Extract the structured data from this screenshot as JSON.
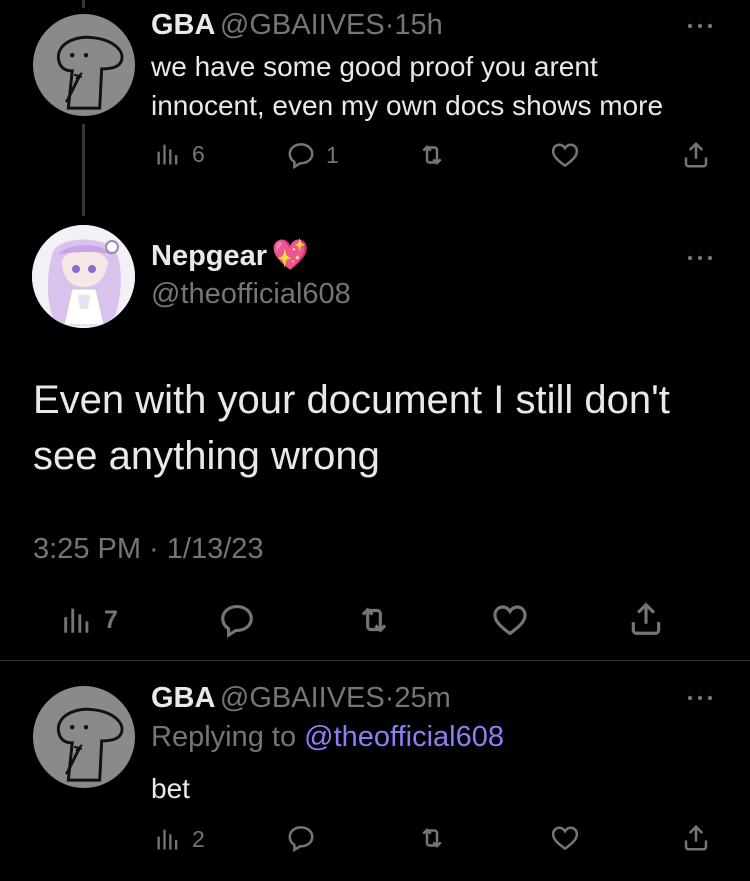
{
  "colors": {
    "background": "#000000",
    "text_primary": "#e7e9ea",
    "text_secondary": "#71767b",
    "link": "#8b7ff5",
    "divider": "#2f3336"
  },
  "tweet1": {
    "display_name": "GBA",
    "handle": "@GBAIIVES",
    "separator": "·",
    "time": "15h",
    "text_line1": "we have some good proof you arent",
    "text_line2": "innocent, even my own docs shows more",
    "views": "6",
    "replies": "1"
  },
  "main_tweet": {
    "display_name": "Nepgear",
    "emoji": "💖",
    "handle": "@theofficial608",
    "text_line1": "Even with your document I still don't",
    "text_line2": "see anything wrong",
    "timestamp": "3:25 PM · 1/13/23",
    "views": "7"
  },
  "reply_tweet": {
    "display_name": "GBA",
    "handle": "@GBAIIVES",
    "separator": "·",
    "time": "25m",
    "replying_prefix": "Replying to",
    "replying_to": "@theofficial608",
    "text": "bet",
    "views": "2"
  },
  "icons": [
    "views-icon",
    "reply-icon",
    "retweet-icon",
    "like-icon",
    "share-icon",
    "more-icon"
  ]
}
